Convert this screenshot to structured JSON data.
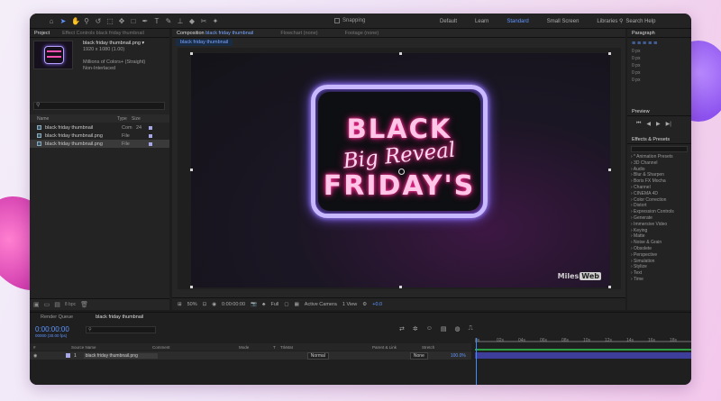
{
  "toolbar": {
    "snapping_label": "Snapping",
    "workspaces": [
      "Default",
      "Learn",
      "Standard",
      "Small Screen",
      "Libraries"
    ],
    "active_workspace": "Standard",
    "help_placeholder": "Search Help"
  },
  "project_panel": {
    "tab_project": "Project",
    "tab_effect_controls": "Effect Controls black friday thumbnail",
    "item_name": "black friday thumbnail.png ▾",
    "item_size": "1920 x 1080 (1.00)",
    "item_colors": "Millions of Colors+ (Straight)",
    "item_scan": "Non-Interlaced",
    "columns": [
      "Name",
      "Type",
      "Size"
    ],
    "rows": [
      {
        "name": "black friday thumbnail",
        "type": "Com",
        "size": "24"
      },
      {
        "name": "black friday thumbnail.png",
        "type": "File",
        "size": ""
      },
      {
        "name": "black friday thumbnail.png",
        "type": "File",
        "size": ""
      }
    ],
    "bpc": "8 bpc"
  },
  "comp_panel": {
    "tab_comp_prefix": "Composition",
    "tab_comp_name": "black friday thumbnail",
    "tab_flowchart": "Flowchart (none)",
    "tab_footage": "Footage (none)",
    "comp_chip": "black friday thumbnail",
    "art_line1": "BLACK",
    "art_line2": "Big Reveal",
    "art_line3": "FRIDAY'S",
    "watermark_a": "Miles",
    "watermark_b": "Web",
    "footer": {
      "zoom": "50%",
      "time": "0:00:00:00",
      "resolution": "Full",
      "camera": "Active Camera",
      "views": "1 View",
      "exposure": "+0.0"
    }
  },
  "right_panel": {
    "paragraph": "Paragraph",
    "para_values": [
      "0 px",
      "0 px",
      "0 px",
      "0 px",
      "0 px"
    ],
    "preview": "Preview",
    "effects": "Effects & Presets",
    "effects_list": [
      "* Animation Presets",
      "3D Channel",
      "Audio",
      "Blur & Sharpen",
      "Boris FX Mocha",
      "Channel",
      "CINEMA 4D",
      "Color Correction",
      "Distort",
      "Expression Controls",
      "Generate",
      "Immersive Video",
      "Keying",
      "Matte",
      "Noise & Grain",
      "Obsolete",
      "Perspective",
      "Simulation",
      "Stylize",
      "Text",
      "Time"
    ]
  },
  "timeline": {
    "tab_render": "Render Queue",
    "tab_comp": "black friday thumbnail",
    "timecode": "0:00:00:00",
    "timecode_sub": "00000 (30.00 fps)",
    "columns": [
      "#",
      "Source Name",
      "Comment",
      "Mode",
      "T",
      "TrkMat",
      "Parent & Link",
      "Stretch"
    ],
    "layer": {
      "index": "1",
      "name": "black friday thumbnail.png",
      "mode": "Normal",
      "parent": "None",
      "stretch": "100.0%"
    },
    "ruler": [
      "0s",
      "02s",
      "04s",
      "06s",
      "08s",
      "10s",
      "12s",
      "14s",
      "16s",
      "18s"
    ]
  }
}
